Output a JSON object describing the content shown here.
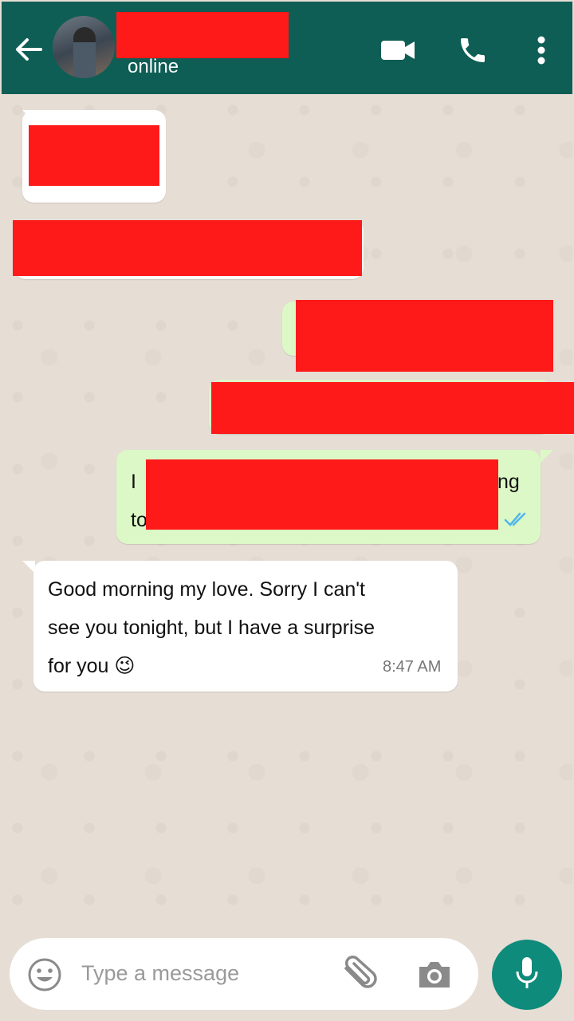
{
  "header": {
    "status": "online",
    "colors": {
      "bar": "#0e5e55",
      "text": "#ffffff"
    },
    "icons": [
      "back-arrow-icon",
      "video-call-icon",
      "voice-call-icon",
      "more-options-icon"
    ]
  },
  "messages": [
    {
      "direction": "incoming",
      "redacted": true
    },
    {
      "direction": "incoming",
      "redacted": true
    },
    {
      "direction": "outgoing",
      "redacted": true
    },
    {
      "direction": "outgoing",
      "redacted": true
    },
    {
      "direction": "outgoing",
      "redacted": true,
      "visible_fragments": {
        "line1_start": "I",
        "line1_end": "ng",
        "line2_start": "to"
      },
      "status": "read"
    },
    {
      "direction": "incoming",
      "lines": [
        "Good morning my love. Sorry I can't",
        "see you tonight, but I have a surprise",
        "for you 😉"
      ],
      "time": "8:47 AM"
    }
  ],
  "composer": {
    "placeholder": "Type a message",
    "icons": [
      "emoji-icon",
      "attach-icon",
      "camera-icon",
      "microphone-icon"
    ]
  },
  "colors": {
    "chat_background": "#e6ddd4",
    "incoming_bubble": "#ffffff",
    "outgoing_bubble": "#dcf8c6",
    "redaction": "#ff1a1a",
    "read_ticks": "#4fb6ec",
    "mic_button": "#0e8b7a"
  }
}
